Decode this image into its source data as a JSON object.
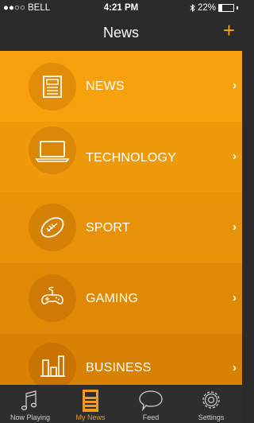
{
  "status_bar": {
    "carrier": "●●○○ BELL",
    "time": "4:21 PM",
    "battery": "22%",
    "battery_level": 0.22
  },
  "nav": {
    "title": "News",
    "add_label": "+"
  },
  "categories": [
    {
      "label": "NEWS",
      "icon": "newspaper-icon",
      "color": "#f7a20c"
    },
    {
      "label": "TECHNOLOGY",
      "icon": "laptop-icon",
      "color": "#ef9a0a"
    },
    {
      "label": "SPORT",
      "icon": "football-icon",
      "color": "#e79208"
    },
    {
      "label": "GAMING",
      "icon": "gamepad-icon",
      "color": "#df8906"
    },
    {
      "label": "BUSINESS",
      "icon": "bar-chart-icon",
      "color": "#d88103"
    }
  ],
  "chevron": "›",
  "tabs": [
    {
      "label": "Now Playing",
      "icon": "music-note-icon",
      "active": false
    },
    {
      "label": "My News",
      "icon": "newspaper-icon",
      "active": true
    },
    {
      "label": "Feed",
      "icon": "speech-bubble-icon",
      "active": false
    },
    {
      "label": "Settings",
      "icon": "gear-icon",
      "active": false
    }
  ],
  "colors": {
    "accent": "#f39a1e",
    "bar_background": "#2b2b2b"
  }
}
